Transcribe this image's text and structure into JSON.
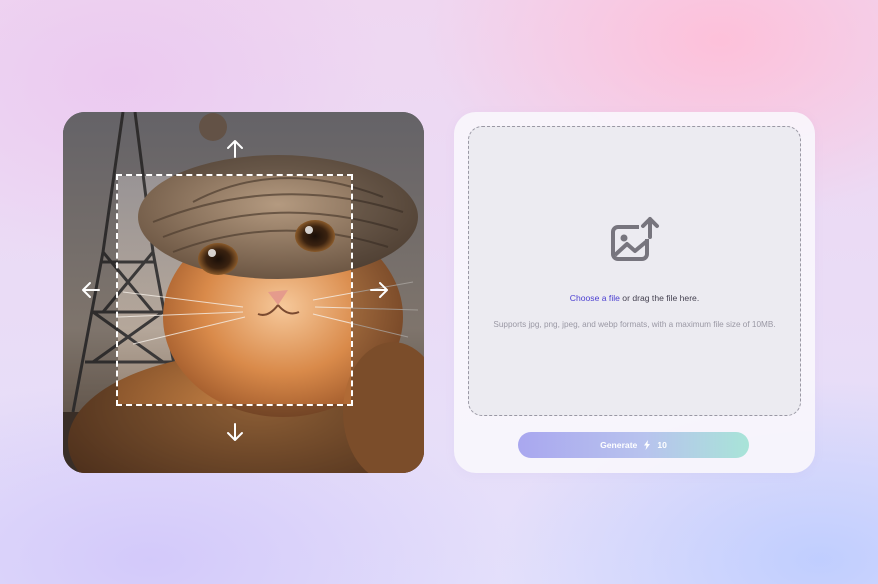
{
  "upload": {
    "choose_file_label": "Choose a file",
    "drag_text": " or drag the file here.",
    "support_text": "Supports jpg, png, jpeg, and webp formats, with a maximum file size of 10MB."
  },
  "generate": {
    "label": "Generate",
    "cost": "10"
  },
  "icons": {
    "upload": "image-upload-icon",
    "bolt": "lightning-bolt-icon",
    "arrows": [
      "arrow-up-icon",
      "arrow-down-icon",
      "arrow-left-icon",
      "arrow-right-icon"
    ]
  },
  "colors": {
    "link": "#4b3fd1",
    "button_gradient_start": "#a9a7ef",
    "button_gradient_end": "#a8e4d8"
  }
}
